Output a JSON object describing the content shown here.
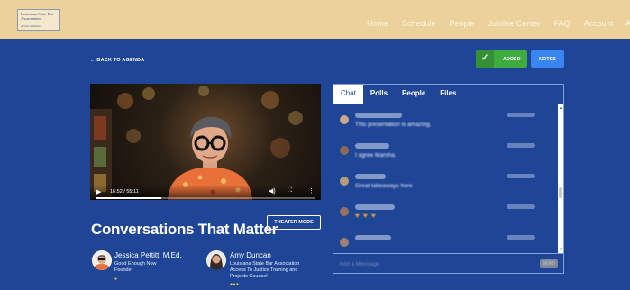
{
  "header": {
    "logo": {
      "line1": "Louisiana State Bar Association",
      "line2": "Access to Justice"
    },
    "nav": [
      "Home",
      "Schedule",
      "People",
      "Jubilee Center",
      "FAQ",
      "Account"
    ],
    "nav_cut": "A"
  },
  "session": {
    "back_label": "← BACK TO AGENDA",
    "added_label": "ADDED",
    "notes_label": "NOTES",
    "title": "Conversations That Matter",
    "theater_label": "THEATER MODE"
  },
  "video": {
    "time": "16:52 / 55:11",
    "progress": 0.3,
    "icons": {
      "play": "play-icon",
      "volume": "volume-icon",
      "fullscreen": "fullscreen-icon",
      "more": "more-vertical-icon"
    }
  },
  "speakers": [
    {
      "name": "Jessica Pettitt, M.Ed.",
      "lines": [
        "Good Enough Now",
        "Founder"
      ],
      "dots": "●"
    },
    {
      "name": "Amy Duncan",
      "lines": [
        "Louisiana State Bar Association",
        "Access To Justice Training and",
        "Projects Counsel"
      ],
      "dots": "●●●"
    }
  ],
  "chat": {
    "tabs": [
      "Chat",
      "Polls",
      "People",
      "Files"
    ],
    "active_tab": "Chat",
    "messages": [
      {
        "text": "This presentation is amazing."
      },
      {
        "text": "I agree Marsha."
      },
      {
        "text": "Great takeaways here"
      },
      {
        "text": "♥ ♥ ♥"
      }
    ],
    "input_placeholder": "Add a Message",
    "send_label": "SEND"
  },
  "colors": {
    "header_bg": "#ecd29a",
    "main_bg": "#1f4597",
    "added_green": "#3fac3f",
    "notes_blue": "#3a86f0",
    "dot_yellow": "#f5d33a"
  }
}
